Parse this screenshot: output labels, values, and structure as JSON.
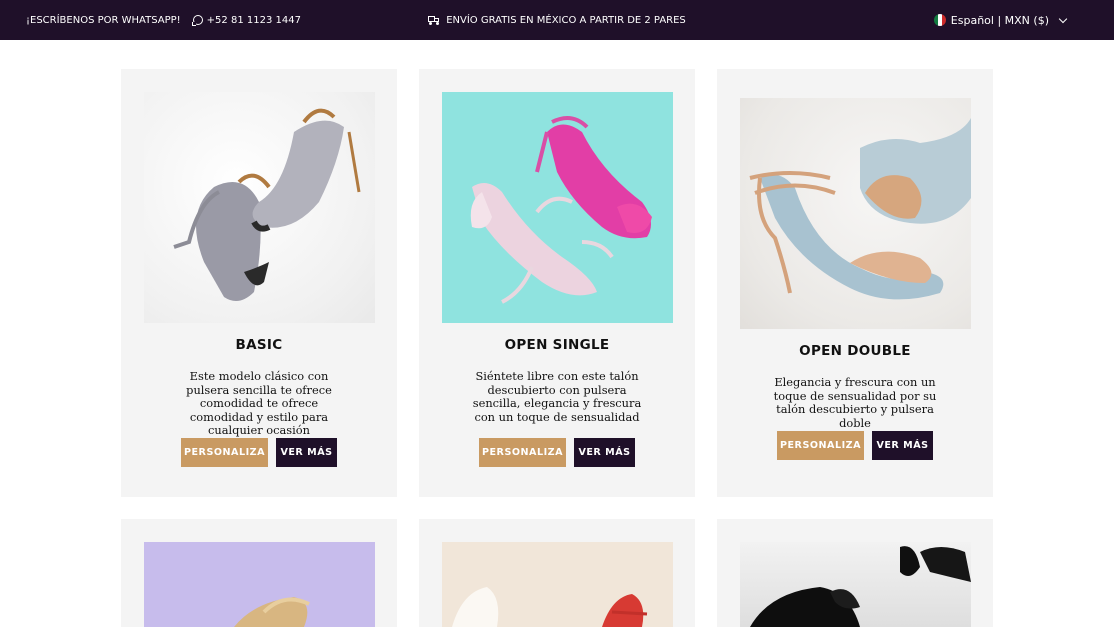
{
  "topbar": {
    "whatsapp_label": "¡ESCRÍBENOS POR WHATSAPP!",
    "phone": "+52 81 1123 1447",
    "shipping_notice": "ENVÍO GRATIS EN MÉXICO A PARTIR DE 2 PARES",
    "locale_selector": "Español | MXN ($)",
    "icons": [
      "whatsapp-icon",
      "truck-icon",
      "mexico-flag-icon",
      "chevron-down-icon"
    ]
  },
  "products": [
    {
      "title": "BASIC",
      "description": "Este modelo clásico con pulsera sencilla te ofrece comodidad te ofrece comodidad y estilo para cualquier ocasión",
      "personaliza_label": "PERSONALIZA",
      "ver_mas_label": "VER MÁS"
    },
    {
      "title": "OPEN SINGLE",
      "description": "Siéntete libre con este talón descubierto con pulsera sencilla, elegancia y frescura con un toque de sensualidad",
      "personaliza_label": "PERSONALIZA",
      "ver_mas_label": "VER MÁS"
    },
    {
      "title": "OPEN DOUBLE",
      "description": "Elegancia y frescura con un toque de sensualidad por su talón descubierto y pulsera doble",
      "personaliza_label": "PERSONALIZA",
      "ver_mas_label": "VER MÁS"
    }
  ],
  "colors": {
    "topbar_bg": "#1f1029",
    "card_bg": "#f4f4f4",
    "personaliza_bg": "#c99a62",
    "ver_mas_bg": "#1f1029"
  }
}
